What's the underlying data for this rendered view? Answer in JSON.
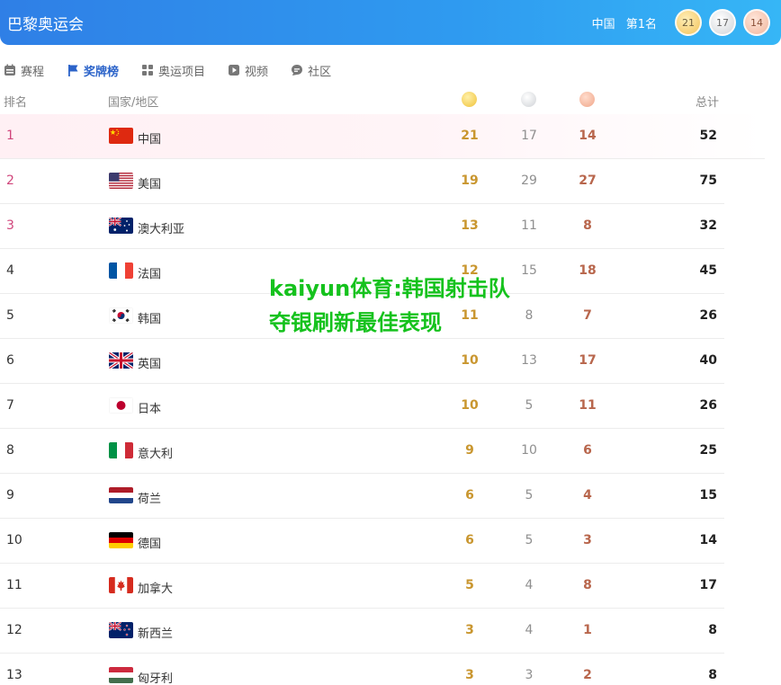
{
  "header": {
    "title": "巴黎奥运会",
    "country": "中国",
    "rank_label": "第1名",
    "gold": "21",
    "silver": "17",
    "bronze": "14"
  },
  "nav": [
    {
      "label": "赛程",
      "icon": "calendar-icon",
      "active": false
    },
    {
      "label": "奖牌榜",
      "icon": "flag-icon",
      "active": true
    },
    {
      "label": "奥运项目",
      "icon": "grid-icon",
      "active": false
    },
    {
      "label": "视频",
      "icon": "play-icon",
      "active": false
    },
    {
      "label": "社区",
      "icon": "chat-icon",
      "active": false
    }
  ],
  "table": {
    "headers": {
      "rank": "排名",
      "country": "国家/地区",
      "total": "总计"
    },
    "rows": [
      {
        "rank": "1",
        "country": "中国",
        "flag": "cn",
        "gold": "21",
        "silver": "17",
        "bronze": "14",
        "total": "52"
      },
      {
        "rank": "2",
        "country": "美国",
        "flag": "us",
        "gold": "19",
        "silver": "29",
        "bronze": "27",
        "total": "75"
      },
      {
        "rank": "3",
        "country": "澳大利亚",
        "flag": "au",
        "gold": "13",
        "silver": "11",
        "bronze": "8",
        "total": "32"
      },
      {
        "rank": "4",
        "country": "法国",
        "flag": "fr",
        "gold": "12",
        "silver": "15",
        "bronze": "18",
        "total": "45"
      },
      {
        "rank": "5",
        "country": "韩国",
        "flag": "kr",
        "gold": "11",
        "silver": "8",
        "bronze": "7",
        "total": "26"
      },
      {
        "rank": "6",
        "country": "英国",
        "flag": "gb",
        "gold": "10",
        "silver": "13",
        "bronze": "17",
        "total": "40"
      },
      {
        "rank": "7",
        "country": "日本",
        "flag": "jp",
        "gold": "10",
        "silver": "5",
        "bronze": "11",
        "total": "26"
      },
      {
        "rank": "8",
        "country": "意大利",
        "flag": "it",
        "gold": "9",
        "silver": "10",
        "bronze": "6",
        "total": "25"
      },
      {
        "rank": "9",
        "country": "荷兰",
        "flag": "nl",
        "gold": "6",
        "silver": "5",
        "bronze": "4",
        "total": "15"
      },
      {
        "rank": "10",
        "country": "德国",
        "flag": "de",
        "gold": "6",
        "silver": "5",
        "bronze": "3",
        "total": "14"
      },
      {
        "rank": "11",
        "country": "加拿大",
        "flag": "ca",
        "gold": "5",
        "silver": "4",
        "bronze": "8",
        "total": "17"
      },
      {
        "rank": "12",
        "country": "新西兰",
        "flag": "nz",
        "gold": "3",
        "silver": "4",
        "bronze": "1",
        "total": "8"
      },
      {
        "rank": "13",
        "country": "匈牙利",
        "flag": "hu",
        "gold": "3",
        "silver": "3",
        "bronze": "2",
        "total": "8"
      }
    ]
  },
  "overlay_text": "kaiyun体育:韩国射击队夺银刷新最佳表现",
  "colors": {
    "header_blue": "#2f8fec",
    "active_nav": "#2b63c9",
    "overlay_green": "#15c21d"
  }
}
